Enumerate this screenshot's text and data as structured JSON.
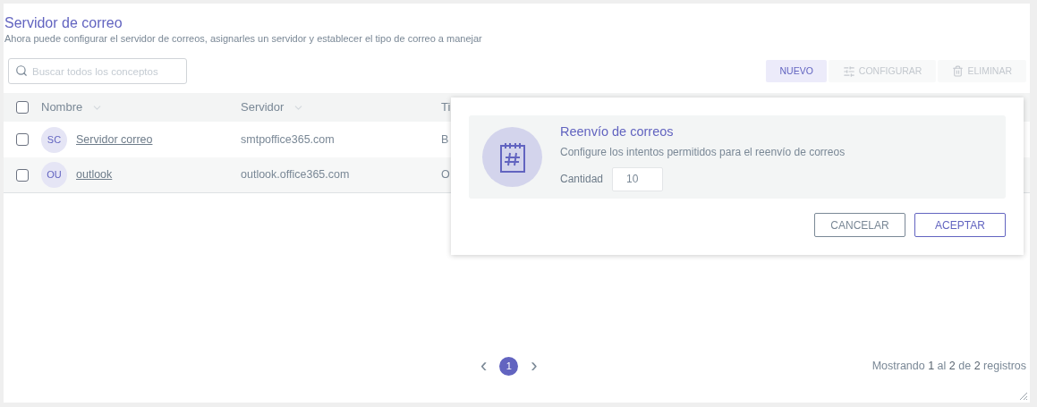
{
  "header": {
    "title": "Servidor de correo",
    "subtitle": "Ahora puede configurar el servidor de correos, asignarles un servidor y establecer el tipo de correo a manejar"
  },
  "search": {
    "placeholder": "Buscar todos los conceptos"
  },
  "toolbar": [
    {
      "label": "NUEVO",
      "kind": "primary",
      "disabled": false
    },
    {
      "label": "CONFIGURAR",
      "kind": "configure",
      "disabled": true
    },
    {
      "label": "ELIMINAR",
      "kind": "delete",
      "disabled": true
    }
  ],
  "table": {
    "select_all": {
      "checked": false
    },
    "columns": [
      {
        "label": "Nombre",
        "sortable": true
      },
      {
        "label": "Servidor",
        "sortable": true
      },
      {
        "label": "Ti",
        "sortable": false
      }
    ],
    "rows": [
      {
        "checked": false,
        "initials": "SC",
        "name": "Servidor correo",
        "server": "smtpoffice365.com",
        "column_3": "B"
      },
      {
        "checked": false,
        "initials": "OU",
        "name": "outlook",
        "server": "outlook.office365.com",
        "column_3": "O"
      }
    ]
  },
  "popover": {
    "title": "Reenvío de correos",
    "description": "Configure los intentos permitidos para el reenvío de correos",
    "field_label": "Cantidad",
    "field_value": "10",
    "buttons": [
      {
        "label": "CANCELAR",
        "kind": "secondary"
      },
      {
        "label": "ACEPTAR",
        "kind": "primary"
      }
    ]
  },
  "pagination": {
    "prev": "‹",
    "next": "›",
    "pages": [
      {
        "label": "1",
        "selected": true
      }
    ],
    "summary": "Mostrando **1** al **2** de **2** registros"
  }
}
